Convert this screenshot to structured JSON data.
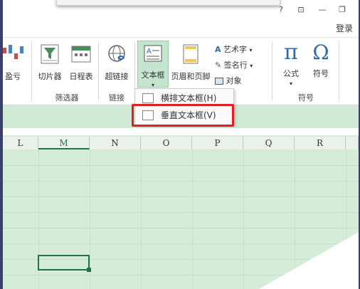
{
  "window_controls": [
    "?",
    "⊡",
    "—",
    "❐"
  ],
  "account": {
    "login": "登录"
  },
  "ribbon": {
    "partial_button": "盈亏",
    "filter_group": {
      "label": "筛选器",
      "buttons": [
        {
          "label": "切片器"
        },
        {
          "label": "日程表"
        }
      ]
    },
    "link_group": {
      "label": "链接",
      "buttons": [
        {
          "label": "超链接"
        }
      ]
    },
    "text_group": {
      "buttons": [
        {
          "label": "文本框"
        },
        {
          "label": "页眉和页脚"
        }
      ],
      "small_buttons": [
        {
          "label": "艺术字"
        },
        {
          "label": "签名行"
        },
        {
          "label": "对象"
        }
      ]
    },
    "symbol_group": {
      "label": "符号",
      "buttons": [
        {
          "label": "公式"
        },
        {
          "label": "符号"
        }
      ]
    }
  },
  "textbox_menu": {
    "items": [
      {
        "label": "横排文本框(H)"
      },
      {
        "label": "垂直文本框(V)"
      }
    ]
  },
  "columns": [
    "L",
    "M",
    "N",
    "O",
    "P",
    "Q",
    "R"
  ],
  "colors": {
    "accent_green": "#217346",
    "grid_bg": "#d5ecd9",
    "highlight_red": "#e0201e"
  }
}
